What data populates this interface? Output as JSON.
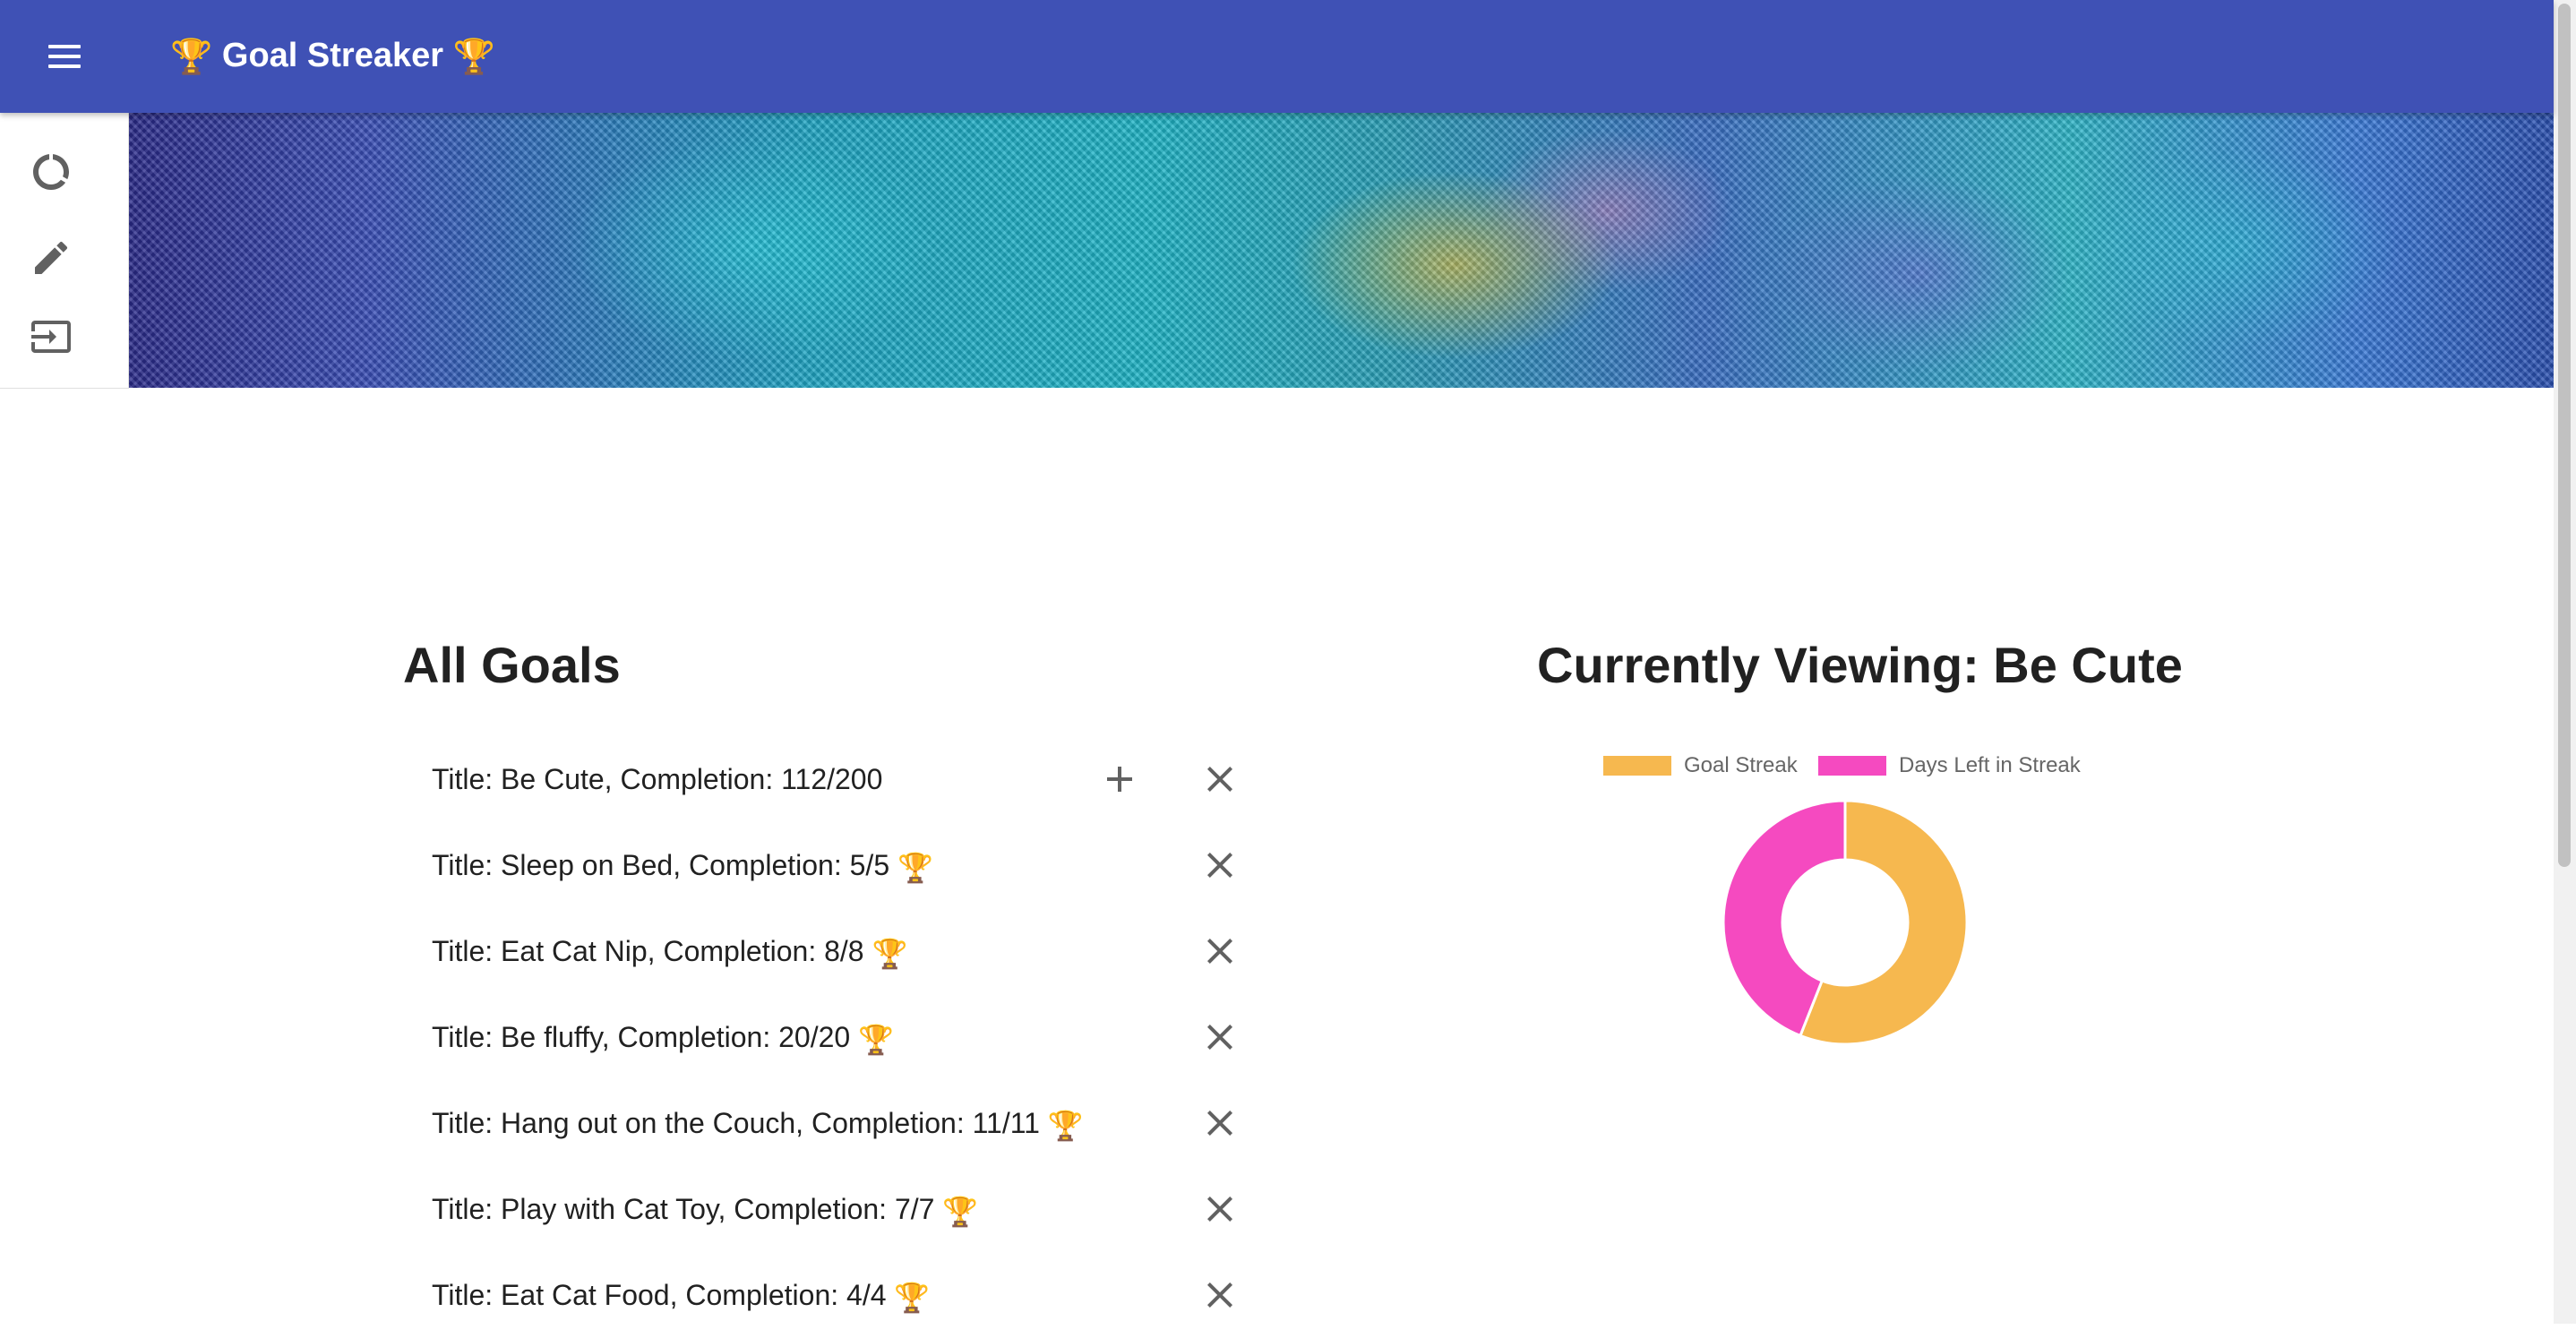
{
  "app": {
    "title": "Goal Streaker",
    "trophy": "🏆",
    "accent_color": "#3f51b5"
  },
  "sidebar": {
    "items": [
      {
        "icon": "progress-circle-icon"
      },
      {
        "icon": "pencil-icon"
      },
      {
        "icon": "logout-icon"
      }
    ]
  },
  "goals_section": {
    "heading": "All Goals",
    "goals": [
      {
        "text": "Title: Be Cute, Completion: 112/200",
        "completed": false
      },
      {
        "text": "Title: Sleep on Bed, Completion: 5/5",
        "completed": true
      },
      {
        "text": "Title: Eat Cat Nip, Completion: 8/8",
        "completed": true
      },
      {
        "text": "Title: Be fluffy, Completion: 20/20",
        "completed": true
      },
      {
        "text": "Title: Hang out on the Couch, Completion: 11/11",
        "completed": true
      },
      {
        "text": "Title: Play with Cat Toy, Completion: 7/7",
        "completed": true
      },
      {
        "text": "Title: Eat Cat Food, Completion: 4/4",
        "completed": true
      }
    ]
  },
  "viewing_section": {
    "heading": "Currently Viewing: Be Cute"
  },
  "chart_data": {
    "type": "pie",
    "variant": "doughnut",
    "legend_position": "top",
    "series": [
      {
        "name": "Goal Streak",
        "value": 112,
        "color": "#f6b84f"
      },
      {
        "name": "Days Left in Streak",
        "value": 88,
        "color": "#f54ac0"
      }
    ]
  }
}
